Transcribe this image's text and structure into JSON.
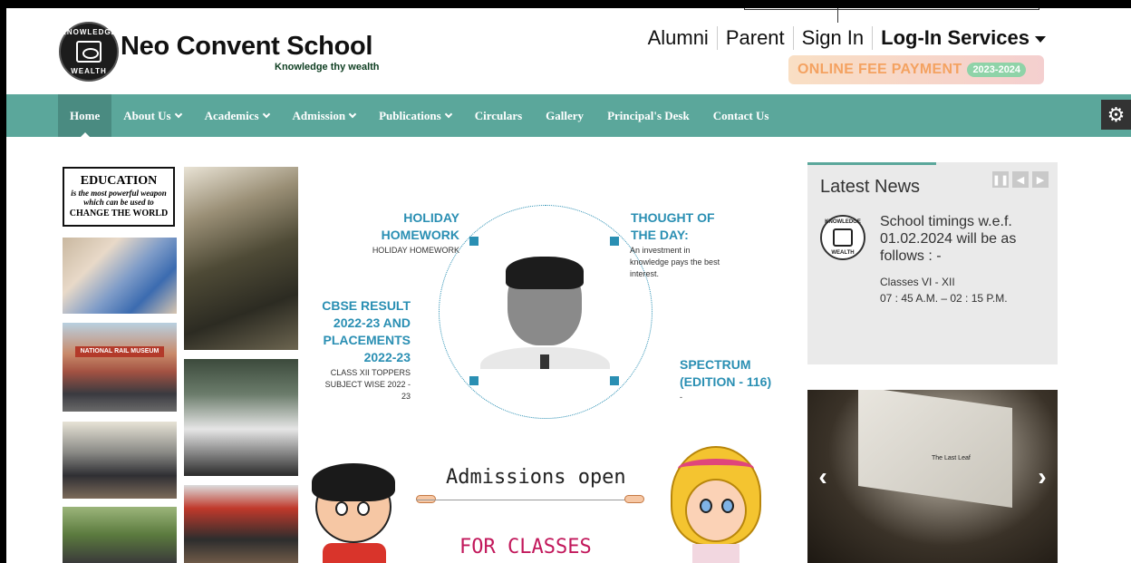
{
  "header": {
    "brand_title": "Neo Convent School",
    "brand_tagline": "Knowledge thy wealth",
    "seal_top": "KNOWLEDGE",
    "seal_bottom": "WEALTH",
    "top_links": [
      {
        "label": "Alumni"
      },
      {
        "label": "Parent"
      },
      {
        "label": "Sign In"
      },
      {
        "label": "Log-In Services"
      }
    ],
    "fee_button": {
      "label": "ONLINE FEE PAYMENT",
      "year": "2023-2024"
    }
  },
  "nav": {
    "items": [
      {
        "label": "Home",
        "active": true
      },
      {
        "label": "About Us",
        "dropdown": true
      },
      {
        "label": "Academics",
        "dropdown": true
      },
      {
        "label": "Admission",
        "dropdown": true
      },
      {
        "label": "Publications",
        "dropdown": true
      },
      {
        "label": "Circulars"
      },
      {
        "label": "Gallery"
      },
      {
        "label": "Principal's Desk"
      },
      {
        "label": "Contact Us"
      }
    ]
  },
  "gallery": {
    "edu_card": {
      "line1": "EDUCATION",
      "line2": "is the most powerful weapon",
      "line3": "which can be used to",
      "line4": "CHANGE THE WORLD"
    },
    "museum_sign": "NATIONAL RAIL MUSEUM"
  },
  "features": {
    "holiday": {
      "title_1": "HOLIDAY",
      "title_2": "HOMEWORK",
      "text": "HOLIDAY HOMEWORK"
    },
    "thought": {
      "title_1": "THOUGHT OF",
      "title_2": "THE DAY:",
      "text_1": "An investment in",
      "text_2": "knowledge pays the best",
      "text_3": "interest."
    },
    "cbse": {
      "title_1": "CBSE RESULT",
      "title_2": "2022-23 AND",
      "title_3": "PLACEMENTS",
      "title_4": "2022-23",
      "text_1": "CLASS XII TOPPERS",
      "text_2": "SUBJECT WISE 2022 -",
      "text_3": "23"
    },
    "spectrum": {
      "title_1": "SPECTRUM",
      "title_2": "(EDITION - 116)",
      "text": "-"
    }
  },
  "banner": {
    "title": "Admissions open",
    "subtitle": "FOR CLASSES"
  },
  "news": {
    "title": "Latest News",
    "headline": "School timings w.e.f. 01.02.2024 will be as follows : -",
    "line1": "Classes VI - XII",
    "line2": "07 : 45 A.M. – 02 : 15 P.M."
  },
  "slideshow": {
    "caption": "The Last Leaf"
  },
  "colors": {
    "nav_bg": "#5ba79b",
    "accent_blue": "#2a8fb3",
    "fee_text": "#f4a261"
  }
}
